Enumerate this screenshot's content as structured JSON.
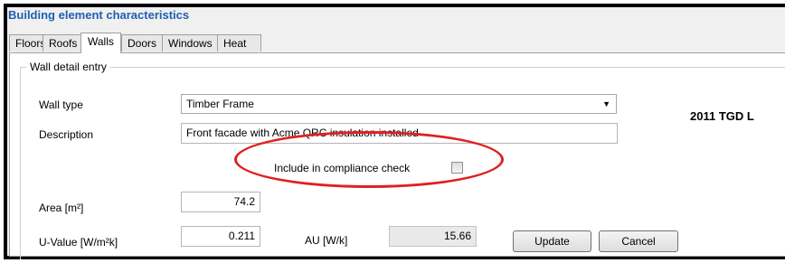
{
  "window": {
    "title": "Building element characteristics"
  },
  "tabs": [
    {
      "label": "Floors",
      "active": false
    },
    {
      "label": "Roofs",
      "active": false
    },
    {
      "label": "Walls",
      "active": true
    },
    {
      "label": "Doors",
      "active": false
    },
    {
      "label": "Windows",
      "active": false
    },
    {
      "label": "Heat loss results",
      "active": false
    }
  ],
  "group": {
    "legend": "Wall detail entry"
  },
  "form": {
    "wall_type_label": "Wall type",
    "wall_type_value": "Timber Frame",
    "description_label": "Description",
    "description_value": "Front facade with Acme QRC  insulation installed",
    "compliance_label": "Include in compliance check",
    "compliance_checked": false,
    "area_label": "Area [m²]",
    "area_value": "74.2",
    "uvalue_label": "U-Value [W/m²k]",
    "uvalue_value": "0.211",
    "au_label": "AU [W/k]",
    "au_value": "15.66"
  },
  "buttons": {
    "update": "Update",
    "cancel": "Cancel"
  },
  "side_heading": "2011 TGD L",
  "colors": {
    "title": "#1f5fb0",
    "highlight": "#e02020"
  },
  "icons": {
    "dropdown": "chevron-down-icon"
  }
}
